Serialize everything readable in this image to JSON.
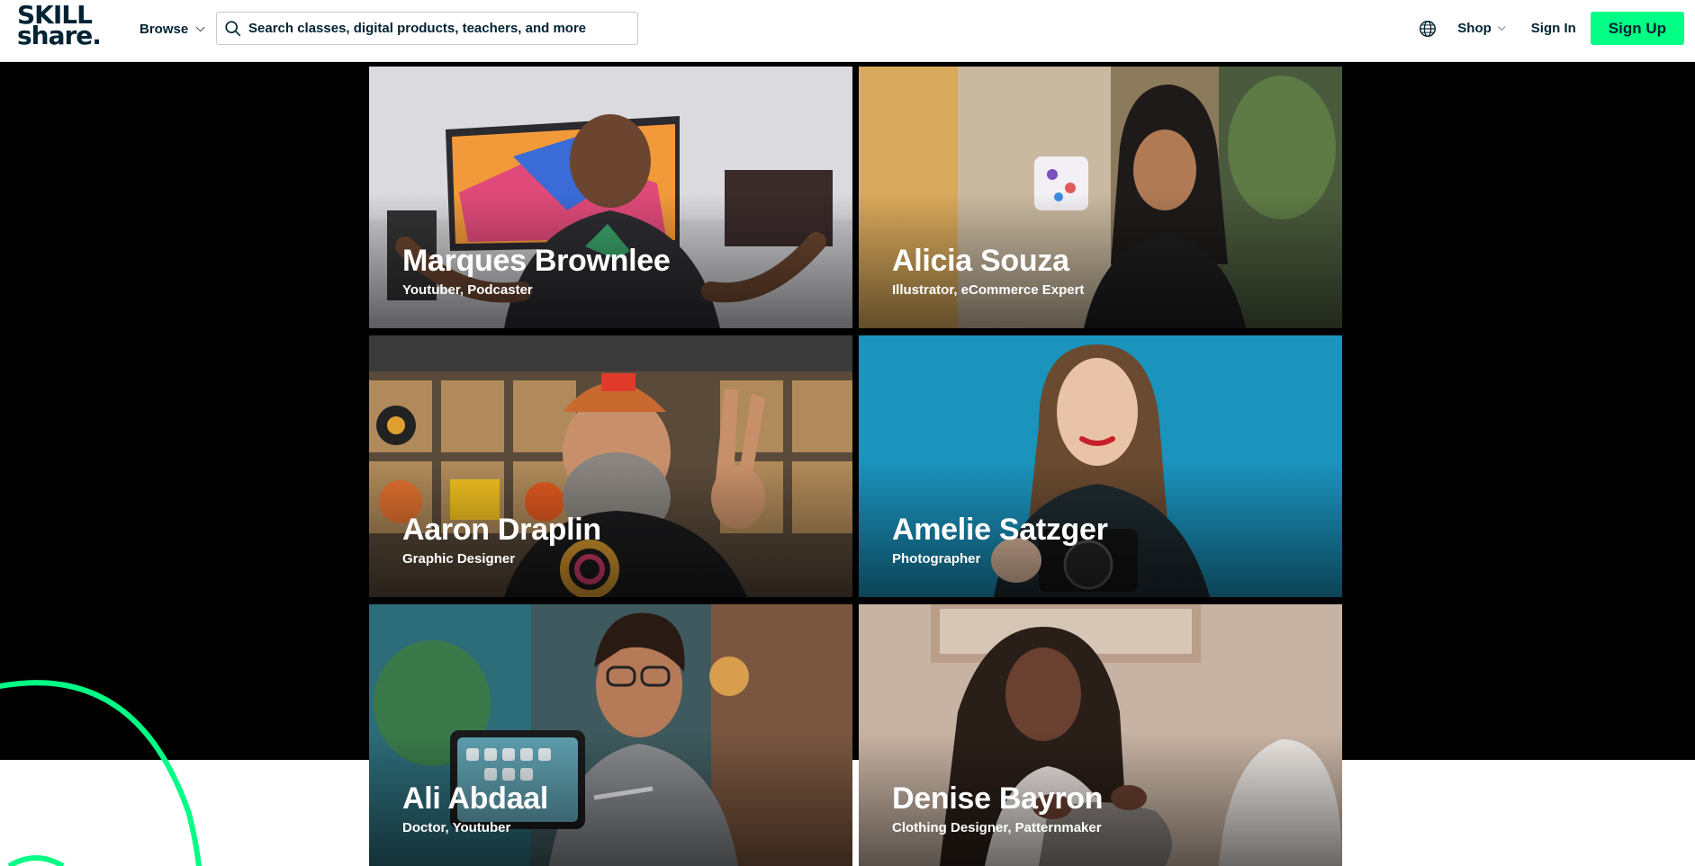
{
  "header": {
    "logo": {
      "line1": "SKILL",
      "line2": "share."
    },
    "browse_label": "Browse",
    "search_placeholder": "Search classes, digital products, teachers, and more",
    "shop_label": "Shop",
    "signin_label": "Sign In",
    "signup_label": "Sign Up"
  },
  "teachers": [
    {
      "name": "Marques Brownlee",
      "role": "Youtuber, Podcaster"
    },
    {
      "name": "Alicia Souza",
      "role": "Illustrator, eCommerce Expert"
    },
    {
      "name": "Aaron Draplin",
      "role": "Graphic Designer"
    },
    {
      "name": "Amelie Satzger",
      "role": "Photographer"
    },
    {
      "name": "Ali Abdaal",
      "role": "Doctor, Youtuber"
    },
    {
      "name": "Denise Bayron",
      "role": "Clothing Designer, Patternmaker"
    }
  ],
  "icons": {
    "search": "search-icon",
    "globe": "globe-icon",
    "chevron": "chevron-down-icon"
  },
  "colors": {
    "brand_green": "#00ff84",
    "text_dark": "#002333",
    "hero_bg": "#000000"
  }
}
